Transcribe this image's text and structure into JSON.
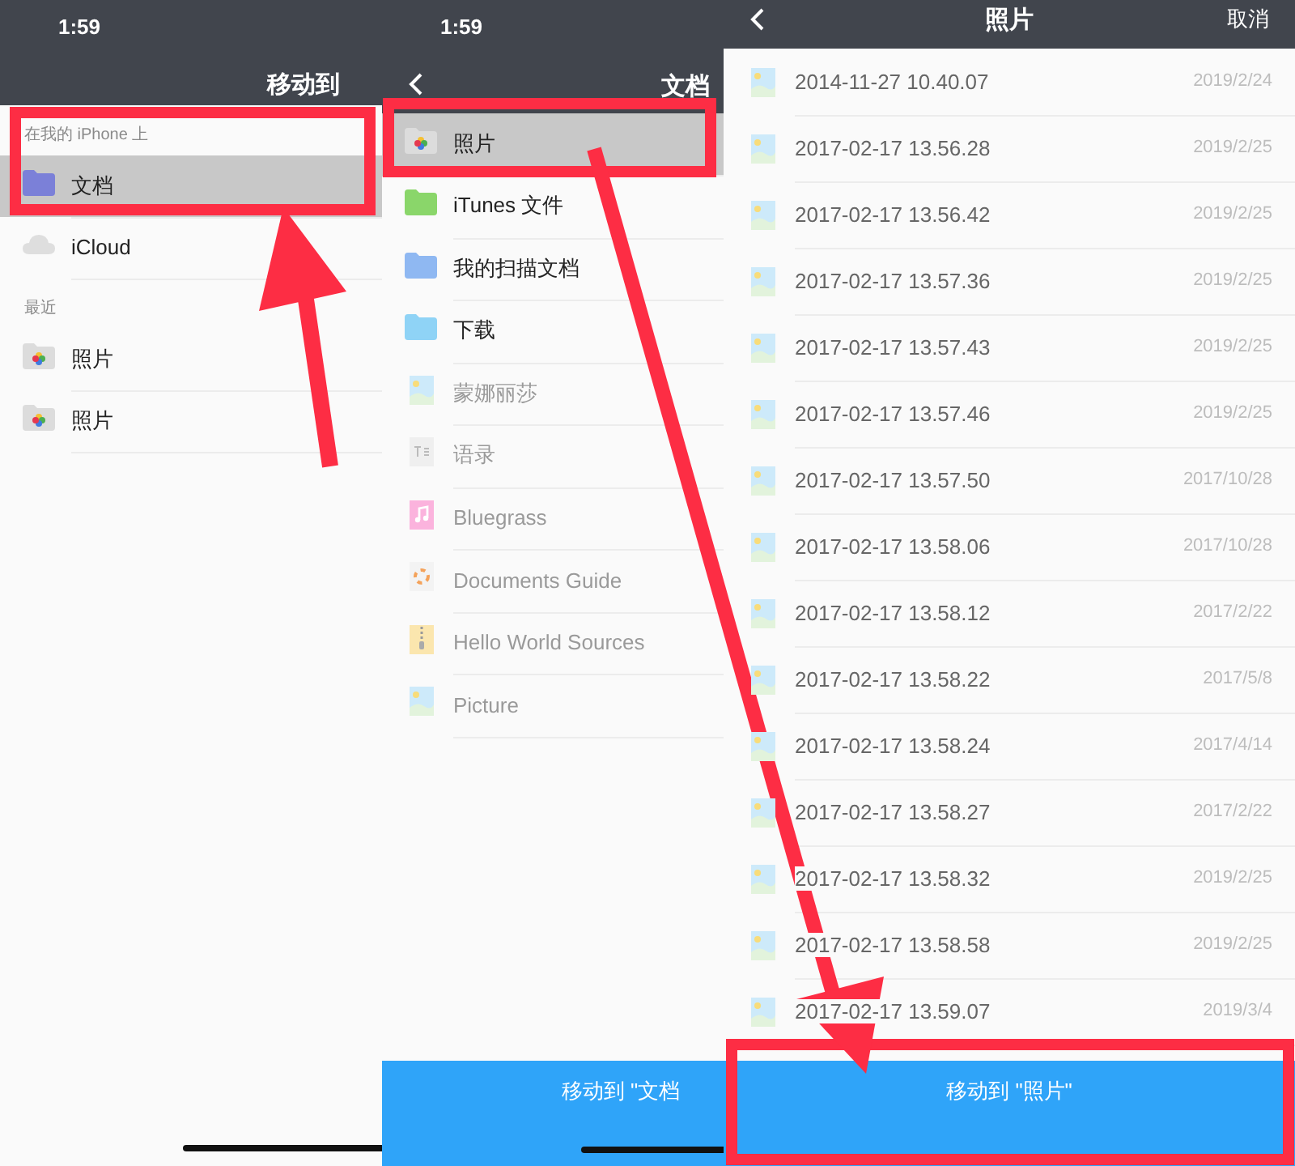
{
  "left_screen": {
    "status_time": "1:59",
    "title": "移动到",
    "sections": [
      {
        "header": "在我的 iPhone 上",
        "items": [
          {
            "label": "文档",
            "kind": "folder",
            "color": "#7b80d8",
            "selected": true
          },
          {
            "label": "iCloud",
            "kind": "cloud",
            "selected": false
          }
        ]
      },
      {
        "header": "最近",
        "items": [
          {
            "label": "照片",
            "kind": "photos",
            "selected": false
          },
          {
            "label": "照片",
            "kind": "photos",
            "selected": false
          }
        ]
      }
    ]
  },
  "middle_screen": {
    "status_time": "1:59",
    "title": "文档",
    "items": [
      {
        "label": "照片",
        "kind": "photos",
        "selected": true,
        "disabled": false
      },
      {
        "label": "iTunes 文件",
        "kind": "folder",
        "color": "#8ad66a",
        "selected": false,
        "disabled": false
      },
      {
        "label": "我的扫描文档",
        "kind": "folder",
        "color": "#8fb8f2",
        "selected": false,
        "disabled": false
      },
      {
        "label": "下载",
        "kind": "folder",
        "color": "#8fd3f6",
        "selected": false,
        "disabled": false
      },
      {
        "label": "蒙娜丽莎",
        "kind": "image",
        "selected": false,
        "disabled": true
      },
      {
        "label": "语录",
        "kind": "text",
        "selected": false,
        "disabled": true
      },
      {
        "label": "Bluegrass",
        "kind": "music",
        "selected": false,
        "disabled": true
      },
      {
        "label": "Documents Guide",
        "kind": "guide",
        "selected": false,
        "disabled": true
      },
      {
        "label": "Hello World Sources",
        "kind": "archive",
        "selected": false,
        "disabled": true
      },
      {
        "label": "Picture",
        "kind": "image",
        "selected": false,
        "disabled": true
      }
    ],
    "action_button": "移动到 \"文档"
  },
  "right_screen": {
    "title": "照片",
    "cancel": "取消",
    "files": [
      {
        "name": "2014-11-27 10.40.07",
        "date": "2019/2/24"
      },
      {
        "name": "2017-02-17 13.56.28",
        "date": "2019/2/25"
      },
      {
        "name": "2017-02-17 13.56.42",
        "date": "2019/2/25"
      },
      {
        "name": "2017-02-17 13.57.36",
        "date": "2019/2/25"
      },
      {
        "name": "2017-02-17 13.57.43",
        "date": "2019/2/25"
      },
      {
        "name": "2017-02-17 13.57.46",
        "date": "2019/2/25"
      },
      {
        "name": "2017-02-17 13.57.50",
        "date": "2017/10/28"
      },
      {
        "name": "2017-02-17 13.58.06",
        "date": "2017/10/28"
      },
      {
        "name": "2017-02-17 13.58.12",
        "date": "2017/2/22"
      },
      {
        "name": "2017-02-17 13.58.22",
        "date": "2017/5/8"
      },
      {
        "name": "2017-02-17 13.58.24",
        "date": "2017/4/14"
      },
      {
        "name": "2017-02-17 13.58.27",
        "date": "2017/2/22"
      },
      {
        "name": "2017-02-17 13.58.32",
        "date": "2019/2/25"
      },
      {
        "name": "2017-02-17 13.58.58",
        "date": "2019/2/25"
      },
      {
        "name": "2017-02-17 13.59.07",
        "date": "2019/3/4"
      }
    ],
    "action_button": "移动到 \"照片\""
  }
}
